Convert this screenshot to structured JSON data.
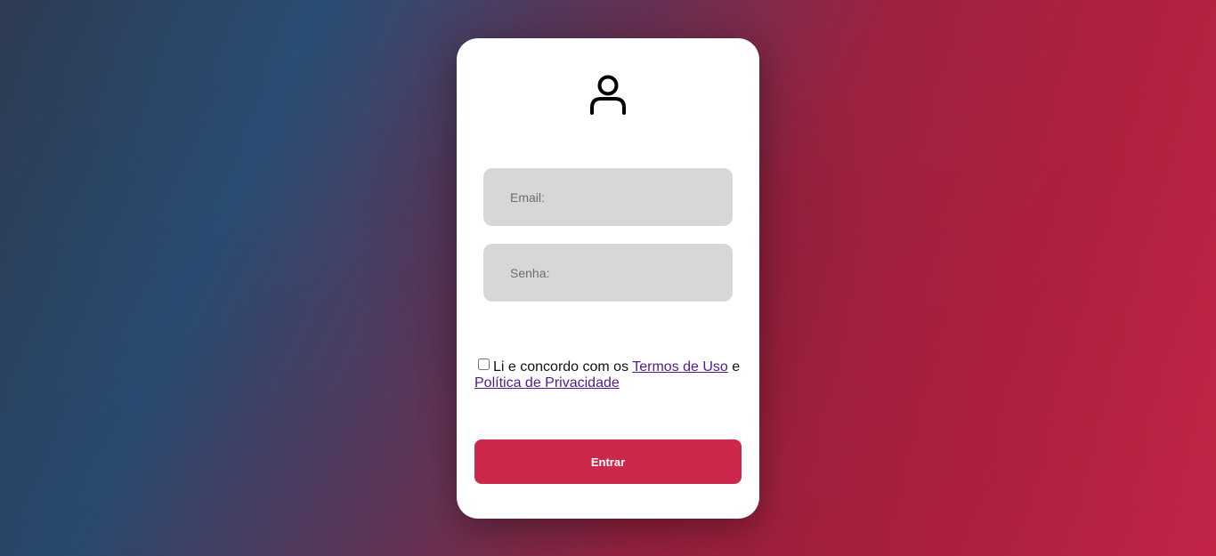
{
  "theme": {
    "accent": "#cc284b",
    "field_bg": "#d8d6d7",
    "link": "#551a8b"
  },
  "login": {
    "icon": "user-icon",
    "email_placeholder": "Email:",
    "senha_placeholder": "Senha:",
    "terms_prefix": "Li e concordo com os",
    "terms_link": "Termos de Uso",
    "terms_joiner": "e",
    "privacy_link": "Política de Privacidade",
    "submit_label": "Entrar"
  }
}
